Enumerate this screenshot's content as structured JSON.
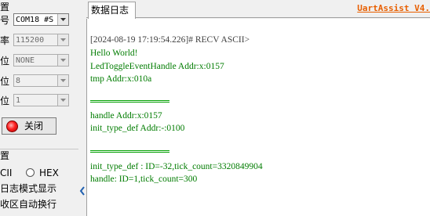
{
  "settings": {
    "port_label": "号",
    "port_value": "COM18 #S",
    "baud_label": "率",
    "baud_value": "115200",
    "parity_label": "位",
    "parity_value": "NONE",
    "databits_label": "位",
    "databits_value": "8",
    "stopbits_label": "位",
    "stopbits_value": "1",
    "close_button_label": "关闭"
  },
  "receive_settings": {
    "title": "置",
    "ascii_option": "CII",
    "hex_option": "HEX",
    "log_mode_option": "日志模式显示",
    "auto_wrap_option": "收区自动换行"
  },
  "tabs": {
    "data_log": "数据日志"
  },
  "brand": "UartAssist V4.",
  "receive_log": {
    "lines_group1": [
      "[2024-08-19 17:19:54.226]# RECV ASCII>",
      "Hello World!",
      "LedToggleEventHandle Addr:x:0157",
      "tmp Addr:x:010a"
    ],
    "lines_group2": [
      "handle Addr:x:0157",
      "init_type_def Addr:-:0100"
    ],
    "lines_group3": [
      "init_type_def : ID=-32,tick_count=3320849904",
      "handle: ID=1,tick_count=300"
    ]
  },
  "colors": {
    "header_text": "#404040",
    "data_text": "#007c00",
    "brand": "#e85f00",
    "led": "#ff2020"
  },
  "icons": [
    "combo-arrow-icon",
    "red-led-icon",
    "chevron-left-icon"
  ]
}
